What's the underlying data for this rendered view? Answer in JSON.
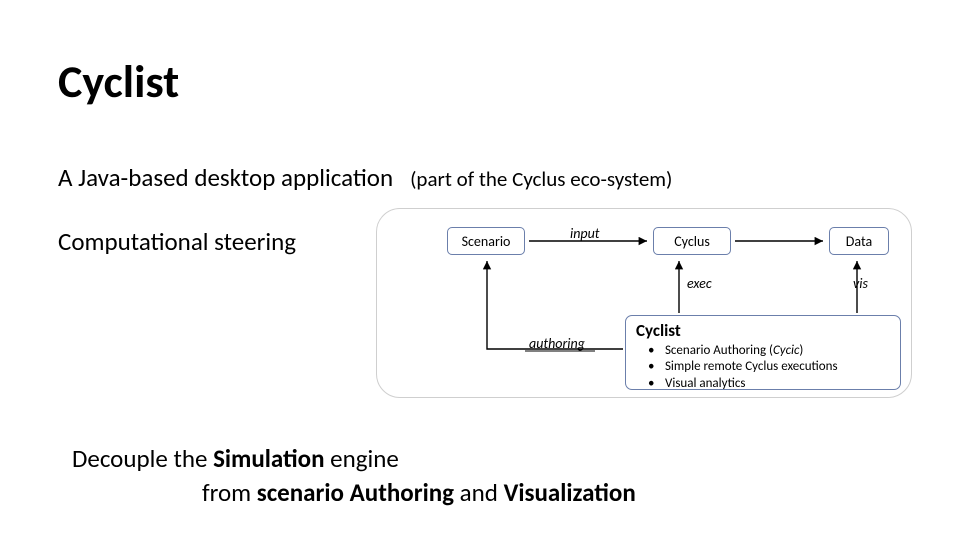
{
  "title": "Cyclist",
  "subtitle_main": "A Java-based desktop application",
  "subtitle_paren": "(part of the Cyclus eco-system)",
  "steering": "Computational steering",
  "diagram": {
    "scenario": "Scenario",
    "cyclus": "Cyclus",
    "data": "Data",
    "labels": {
      "input": "input",
      "exec": "exec",
      "vis": "vis",
      "authoring": "authoring"
    },
    "cyclist_box": {
      "header": "Cyclist",
      "items": [
        {
          "pre": "Scenario Authoring (",
          "emph": "Cycic",
          "post": ")"
        },
        {
          "pre": "Simple remote Cyclus executions",
          "emph": "",
          "post": ""
        },
        {
          "pre": "Visual analytics",
          "emph": "",
          "post": ""
        }
      ]
    }
  },
  "decouple": {
    "l1a": "Decouple the ",
    "l1b": "Simulation",
    "l1c": " engine",
    "l2a": "from ",
    "l2b": "scenario Authoring",
    "l2c": " and ",
    "l2d": "Visualization"
  }
}
